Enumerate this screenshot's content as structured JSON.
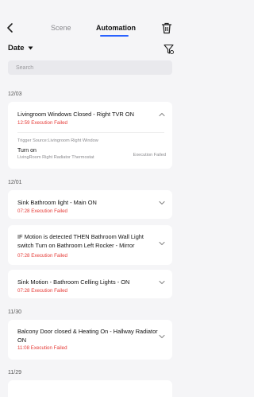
{
  "header": {
    "tabs": [
      {
        "label": "Scene",
        "active": false
      },
      {
        "label": "Automation",
        "active": true
      }
    ],
    "accent_color": "#2a62ff"
  },
  "filter": {
    "sort_label": "Date",
    "sort_icon": "caret-down-icon",
    "filter_icon": "filter-icon"
  },
  "search": {
    "placeholder": "Search"
  },
  "groups": [
    {
      "date": "12/03",
      "items": [
        {
          "title": "Livingroom Windows Closed - Right TVR ON",
          "time": "12:59",
          "status": "Execution Failed",
          "expanded": true,
          "detail": {
            "trigger_source": "Trigger Source:Livingroom Right Window",
            "action": "Turn on",
            "device": "LivingRoom Right Radiator Thermostat",
            "result": "Execution Failed"
          }
        }
      ]
    },
    {
      "date": "12/01",
      "items": [
        {
          "title": "Sink Bathroom light - Main ON",
          "time": "07:28",
          "status": "Execution Failed",
          "expanded": false
        },
        {
          "title": "IF Motion is detected THEN Bathroom Wall Light switch Turn on Bathroom Left Rocker - Mirror",
          "time": "07:28",
          "status": "Execution Failed",
          "expanded": false
        },
        {
          "title": "Sink Motion - Bathroom Celling Lights - ON",
          "time": "07:28",
          "status": "Execution Failed",
          "expanded": false
        }
      ]
    },
    {
      "date": "11/30",
      "items": [
        {
          "title": "Balcony Door closed & Heating On - Hallway Radiator ON",
          "time": "11:08",
          "status": "Execution Failed",
          "expanded": false
        }
      ]
    },
    {
      "date": "11/29",
      "items": []
    }
  ],
  "status_color": "#e53935"
}
